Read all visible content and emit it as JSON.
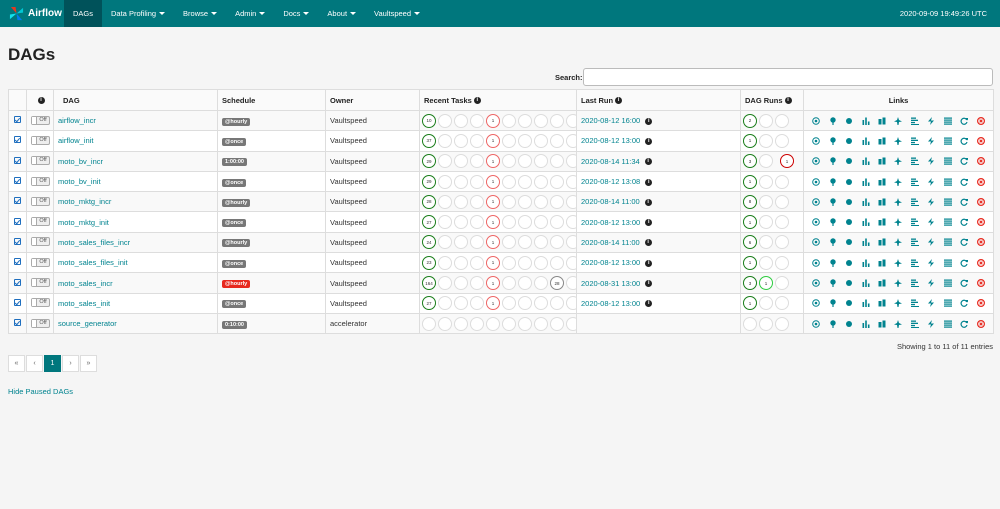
{
  "navbar": {
    "brand": "Airflow",
    "items": [
      {
        "label": "DAGs",
        "caret": false,
        "active": true
      },
      {
        "label": "Data Profiling",
        "caret": true
      },
      {
        "label": "Browse",
        "caret": true
      },
      {
        "label": "Admin",
        "caret": true
      },
      {
        "label": "Docs",
        "caret": true
      },
      {
        "label": "About",
        "caret": true
      },
      {
        "label": "Vaultspeed",
        "caret": true
      }
    ],
    "time": "2020-09-09 19:49:26 UTC"
  },
  "page_title": "DAGs",
  "search": {
    "label": "Search:",
    "value": ""
  },
  "table": {
    "headers": {
      "info": "i",
      "dag": "DAG",
      "schedule": "Schedule",
      "owner": "Owner",
      "recent_tasks": "Recent Tasks",
      "last_run": "Last Run",
      "dag_runs": "DAG Runs",
      "links": "Links"
    },
    "toggle_label": "Off",
    "rows": [
      {
        "dag": "airflow_incr",
        "schedule": "@hourly",
        "sched_red": false,
        "owner": "Vaultspeed",
        "last_run": "2020-08-12 16:00",
        "tasks": [
          [
            "green",
            "10"
          ],
          [
            "",
            ""
          ],
          [
            "",
            ""
          ],
          [
            "",
            ""
          ],
          [
            "red",
            "1"
          ],
          [
            "",
            ""
          ],
          [
            "",
            ""
          ],
          [
            "",
            ""
          ],
          [
            "",
            ""
          ],
          [
            "",
            ""
          ]
        ],
        "runs": [
          [
            "green",
            "2"
          ],
          [
            "",
            ""
          ],
          [
            "",
            ""
          ]
        ]
      },
      {
        "dag": "airflow_init",
        "schedule": "@once",
        "sched_red": false,
        "owner": "Vaultspeed",
        "last_run": "2020-08-12 13:00",
        "tasks": [
          [
            "green",
            "37"
          ],
          [
            "",
            ""
          ],
          [
            "",
            ""
          ],
          [
            "",
            ""
          ],
          [
            "red",
            "1"
          ],
          [
            "",
            ""
          ],
          [
            "",
            ""
          ],
          [
            "",
            ""
          ],
          [
            "",
            ""
          ],
          [
            "",
            ""
          ]
        ],
        "runs": [
          [
            "green",
            "1"
          ],
          [
            "",
            ""
          ],
          [
            "",
            ""
          ]
        ]
      },
      {
        "dag": "moto_bv_incr",
        "schedule": "1:00:00",
        "sched_red": false,
        "owner": "Vaultspeed",
        "last_run": "2020-08-14 11:34",
        "tasks": [
          [
            "green",
            "29"
          ],
          [
            "",
            ""
          ],
          [
            "",
            ""
          ],
          [
            "",
            ""
          ],
          [
            "red",
            "1"
          ],
          [
            "",
            ""
          ],
          [
            "",
            ""
          ],
          [
            "",
            ""
          ],
          [
            "",
            ""
          ],
          [
            "",
            ""
          ]
        ],
        "runs": [
          [
            "green",
            "3"
          ],
          [
            "",
            ""
          ],
          [
            "darkred",
            "1"
          ]
        ]
      },
      {
        "dag": "moto_bv_init",
        "schedule": "@once",
        "sched_red": false,
        "owner": "Vaultspeed",
        "last_run": "2020-08-12 13:08",
        "tasks": [
          [
            "green",
            "29"
          ],
          [
            "",
            ""
          ],
          [
            "",
            ""
          ],
          [
            "",
            ""
          ],
          [
            "red",
            "1"
          ],
          [
            "",
            ""
          ],
          [
            "",
            ""
          ],
          [
            "",
            ""
          ],
          [
            "",
            ""
          ],
          [
            "",
            ""
          ]
        ],
        "runs": [
          [
            "green",
            "1"
          ],
          [
            "",
            ""
          ],
          [
            "",
            ""
          ]
        ]
      },
      {
        "dag": "moto_mktg_incr",
        "schedule": "@hourly",
        "sched_red": false,
        "owner": "Vaultspeed",
        "last_run": "2020-08-14 11:00",
        "tasks": [
          [
            "green",
            "28"
          ],
          [
            "",
            ""
          ],
          [
            "",
            ""
          ],
          [
            "",
            ""
          ],
          [
            "red",
            "1"
          ],
          [
            "",
            ""
          ],
          [
            "",
            ""
          ],
          [
            "",
            ""
          ],
          [
            "",
            ""
          ],
          [
            "",
            ""
          ]
        ],
        "runs": [
          [
            "green",
            "8"
          ],
          [
            "",
            ""
          ],
          [
            "",
            ""
          ]
        ]
      },
      {
        "dag": "moto_mktg_init",
        "schedule": "@once",
        "sched_red": false,
        "owner": "Vaultspeed",
        "last_run": "2020-08-12 13:00",
        "tasks": [
          [
            "green",
            "27"
          ],
          [
            "",
            ""
          ],
          [
            "",
            ""
          ],
          [
            "",
            ""
          ],
          [
            "red",
            "1"
          ],
          [
            "",
            ""
          ],
          [
            "",
            ""
          ],
          [
            "",
            ""
          ],
          [
            "",
            ""
          ],
          [
            "",
            ""
          ]
        ],
        "runs": [
          [
            "green",
            "1"
          ],
          [
            "",
            ""
          ],
          [
            "",
            ""
          ]
        ]
      },
      {
        "dag": "moto_sales_files_incr",
        "schedule": "@hourly",
        "sched_red": false,
        "owner": "Vaultspeed",
        "last_run": "2020-08-14 11:00",
        "tasks": [
          [
            "green",
            "24"
          ],
          [
            "",
            ""
          ],
          [
            "",
            ""
          ],
          [
            "",
            ""
          ],
          [
            "red",
            "1"
          ],
          [
            "",
            ""
          ],
          [
            "",
            ""
          ],
          [
            "",
            ""
          ],
          [
            "",
            ""
          ],
          [
            "",
            ""
          ]
        ],
        "runs": [
          [
            "green",
            "6"
          ],
          [
            "",
            ""
          ],
          [
            "",
            ""
          ]
        ]
      },
      {
        "dag": "moto_sales_files_init",
        "schedule": "@once",
        "sched_red": false,
        "owner": "Vaultspeed",
        "last_run": "2020-08-12 13:00",
        "tasks": [
          [
            "green",
            "23"
          ],
          [
            "",
            ""
          ],
          [
            "",
            ""
          ],
          [
            "",
            ""
          ],
          [
            "red",
            "1"
          ],
          [
            "",
            ""
          ],
          [
            "",
            ""
          ],
          [
            "",
            ""
          ],
          [
            "",
            ""
          ],
          [
            "",
            ""
          ]
        ],
        "runs": [
          [
            "green",
            "1"
          ],
          [
            "",
            ""
          ],
          [
            "",
            ""
          ]
        ]
      },
      {
        "dag": "moto_sales_incr",
        "schedule": "@hourly",
        "sched_red": true,
        "owner": "Vaultspeed",
        "last_run": "2020-08-31 13:00",
        "tasks": [
          [
            "green",
            "164"
          ],
          [
            "",
            ""
          ],
          [
            "",
            ""
          ],
          [
            "",
            ""
          ],
          [
            "red",
            "1"
          ],
          [
            "",
            ""
          ],
          [
            "",
            ""
          ],
          [
            "",
            ""
          ],
          [
            "grey",
            "28"
          ],
          [
            "",
            ""
          ]
        ],
        "runs": [
          [
            "green",
            "3"
          ],
          [
            "lime",
            "1"
          ],
          [
            "",
            ""
          ]
        ]
      },
      {
        "dag": "moto_sales_init",
        "schedule": "@once",
        "sched_red": false,
        "owner": "Vaultspeed",
        "last_run": "2020-08-12 13:00",
        "tasks": [
          [
            "green",
            "27"
          ],
          [
            "",
            ""
          ],
          [
            "",
            ""
          ],
          [
            "",
            ""
          ],
          [
            "red",
            "1"
          ],
          [
            "",
            ""
          ],
          [
            "",
            ""
          ],
          [
            "",
            ""
          ],
          [
            "",
            ""
          ],
          [
            "",
            ""
          ]
        ],
        "runs": [
          [
            "green",
            "1"
          ],
          [
            "",
            ""
          ],
          [
            "",
            ""
          ]
        ]
      },
      {
        "dag": "source_generator",
        "schedule": "0:10:00",
        "sched_red": false,
        "owner": "accelerator",
        "last_run": "",
        "tasks": [
          [
            "",
            ""
          ],
          [
            "",
            ""
          ],
          [
            "",
            ""
          ],
          [
            "",
            ""
          ],
          [
            "",
            ""
          ],
          [
            "",
            ""
          ],
          [
            "",
            ""
          ],
          [
            "",
            ""
          ],
          [
            "",
            ""
          ],
          [
            "",
            ""
          ]
        ],
        "runs": [
          [
            "",
            ""
          ],
          [
            "",
            ""
          ],
          [
            "",
            ""
          ]
        ]
      }
    ]
  },
  "link_icons": [
    "trigger-dag-icon",
    "tree-view-icon",
    "graph-view-icon",
    "task-duration-icon",
    "task-tries-icon",
    "landing-times-icon",
    "gantt-icon",
    "code-icon",
    "logs-icon",
    "refresh-icon",
    "delete-icon"
  ],
  "colors": {
    "nav": "#00777d",
    "link": "#00838f",
    "success": "#1a7d1a",
    "failed": "#e7291f"
  },
  "footer": {
    "showing": "Showing 1 to 11 of 11 entries",
    "hide_paused": "Hide Paused DAGs"
  },
  "pager": [
    "«",
    "‹",
    "1",
    "›",
    "»"
  ]
}
